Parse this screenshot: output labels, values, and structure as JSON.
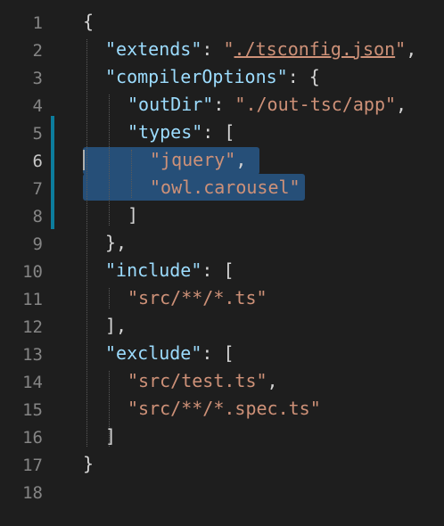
{
  "editor": {
    "colors": {
      "background": "#1e1e1e",
      "key": "#9cdcfe",
      "string": "#ce9178",
      "punctuation": "#d4d4d4",
      "line_number": "#858585",
      "selection": "#264f78",
      "gutter_modified": "#0c7d9d"
    },
    "lines": [
      {
        "n": "1",
        "indent": 0,
        "tokens": [
          {
            "t": "{",
            "c": "punct"
          }
        ]
      },
      {
        "n": "2",
        "indent": 1,
        "tokens": [
          {
            "t": "\"extends\"",
            "c": "key"
          },
          {
            "t": ": ",
            "c": "punct"
          },
          {
            "t": "\"",
            "c": "str"
          },
          {
            "t": "./tsconfig.json",
            "c": "link"
          },
          {
            "t": "\"",
            "c": "str"
          },
          {
            "t": ",",
            "c": "punct"
          }
        ]
      },
      {
        "n": "3",
        "indent": 1,
        "tokens": [
          {
            "t": "\"compilerOptions\"",
            "c": "key"
          },
          {
            "t": ": {",
            "c": "punct"
          }
        ]
      },
      {
        "n": "4",
        "indent": 2,
        "tokens": [
          {
            "t": "\"outDir\"",
            "c": "key"
          },
          {
            "t": ": ",
            "c": "punct"
          },
          {
            "t": "\"./out-tsc/app\"",
            "c": "str"
          },
          {
            "t": ",",
            "c": "punct"
          }
        ]
      },
      {
        "n": "5",
        "indent": 2,
        "tokens": [
          {
            "t": "\"types\"",
            "c": "key"
          },
          {
            "t": ": [",
            "c": "punct"
          }
        ]
      },
      {
        "n": "6",
        "indent": 3,
        "active": true,
        "tokens": [
          {
            "t": "\"jquery\"",
            "c": "str"
          },
          {
            "t": ",",
            "c": "punct"
          }
        ]
      },
      {
        "n": "7",
        "indent": 3,
        "tokens": [
          {
            "t": "\"owl.carousel\"",
            "c": "str"
          }
        ]
      },
      {
        "n": "8",
        "indent": 2,
        "tokens": [
          {
            "t": "]",
            "c": "punct"
          }
        ]
      },
      {
        "n": "9",
        "indent": 1,
        "tokens": [
          {
            "t": "},",
            "c": "punct"
          }
        ]
      },
      {
        "n": "10",
        "indent": 1,
        "tokens": [
          {
            "t": "\"include\"",
            "c": "key"
          },
          {
            "t": ": [",
            "c": "punct"
          }
        ]
      },
      {
        "n": "11",
        "indent": 2,
        "tokens": [
          {
            "t": "\"src/**/*.ts\"",
            "c": "str"
          }
        ]
      },
      {
        "n": "12",
        "indent": 1,
        "tokens": [
          {
            "t": "],",
            "c": "punct"
          }
        ]
      },
      {
        "n": "13",
        "indent": 1,
        "tokens": [
          {
            "t": "\"exclude\"",
            "c": "key"
          },
          {
            "t": ": [",
            "c": "punct"
          }
        ]
      },
      {
        "n": "14",
        "indent": 2,
        "tokens": [
          {
            "t": "\"src/test.ts\"",
            "c": "str"
          },
          {
            "t": ",",
            "c": "punct"
          }
        ]
      },
      {
        "n": "15",
        "indent": 2,
        "tokens": [
          {
            "t": "\"src/**/*.spec.ts\"",
            "c": "str"
          }
        ]
      },
      {
        "n": "16",
        "indent": 1,
        "tokens": [
          {
            "t": "]",
            "c": "punct"
          }
        ]
      },
      {
        "n": "17",
        "indent": 0,
        "tokens": [
          {
            "t": "}",
            "c": "punct"
          }
        ]
      },
      {
        "n": "18",
        "indent": 0,
        "tokens": []
      }
    ]
  }
}
